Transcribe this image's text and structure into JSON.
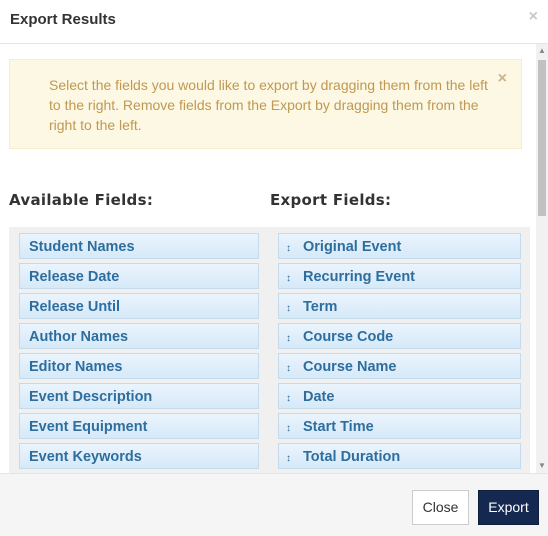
{
  "dialog": {
    "title": "Export Results",
    "close_glyph": "×"
  },
  "alert": {
    "text": "Select the fields you would like to export by dragging them from the left to the right. Remove fields from the Export by dragging them from the right to the left.",
    "close_glyph": "×"
  },
  "available": {
    "heading": "Available Fields:",
    "items": [
      "Student Names",
      "Release Date",
      "Release Until",
      "Author Names",
      "Editor Names",
      "Event Description",
      "Event Equipment",
      "Event Keywords"
    ]
  },
  "export": {
    "heading": "Export Fields:",
    "grip_glyph": "↕",
    "items": [
      "Original Event",
      "Recurring Event",
      "Term",
      "Course Code",
      "Course Name",
      "Date",
      "Start Time",
      "Total Duration"
    ]
  },
  "footer": {
    "close_label": "Close",
    "export_label": "Export"
  },
  "colors": {
    "alert_bg": "#fcf8e3",
    "alert_text": "#c09853",
    "item_text": "#2e6e9e",
    "primary_button": "#142850"
  },
  "icons": {
    "dialog_close": "close-icon",
    "alert_close": "close-icon",
    "drag": "drag-handle-icon"
  }
}
